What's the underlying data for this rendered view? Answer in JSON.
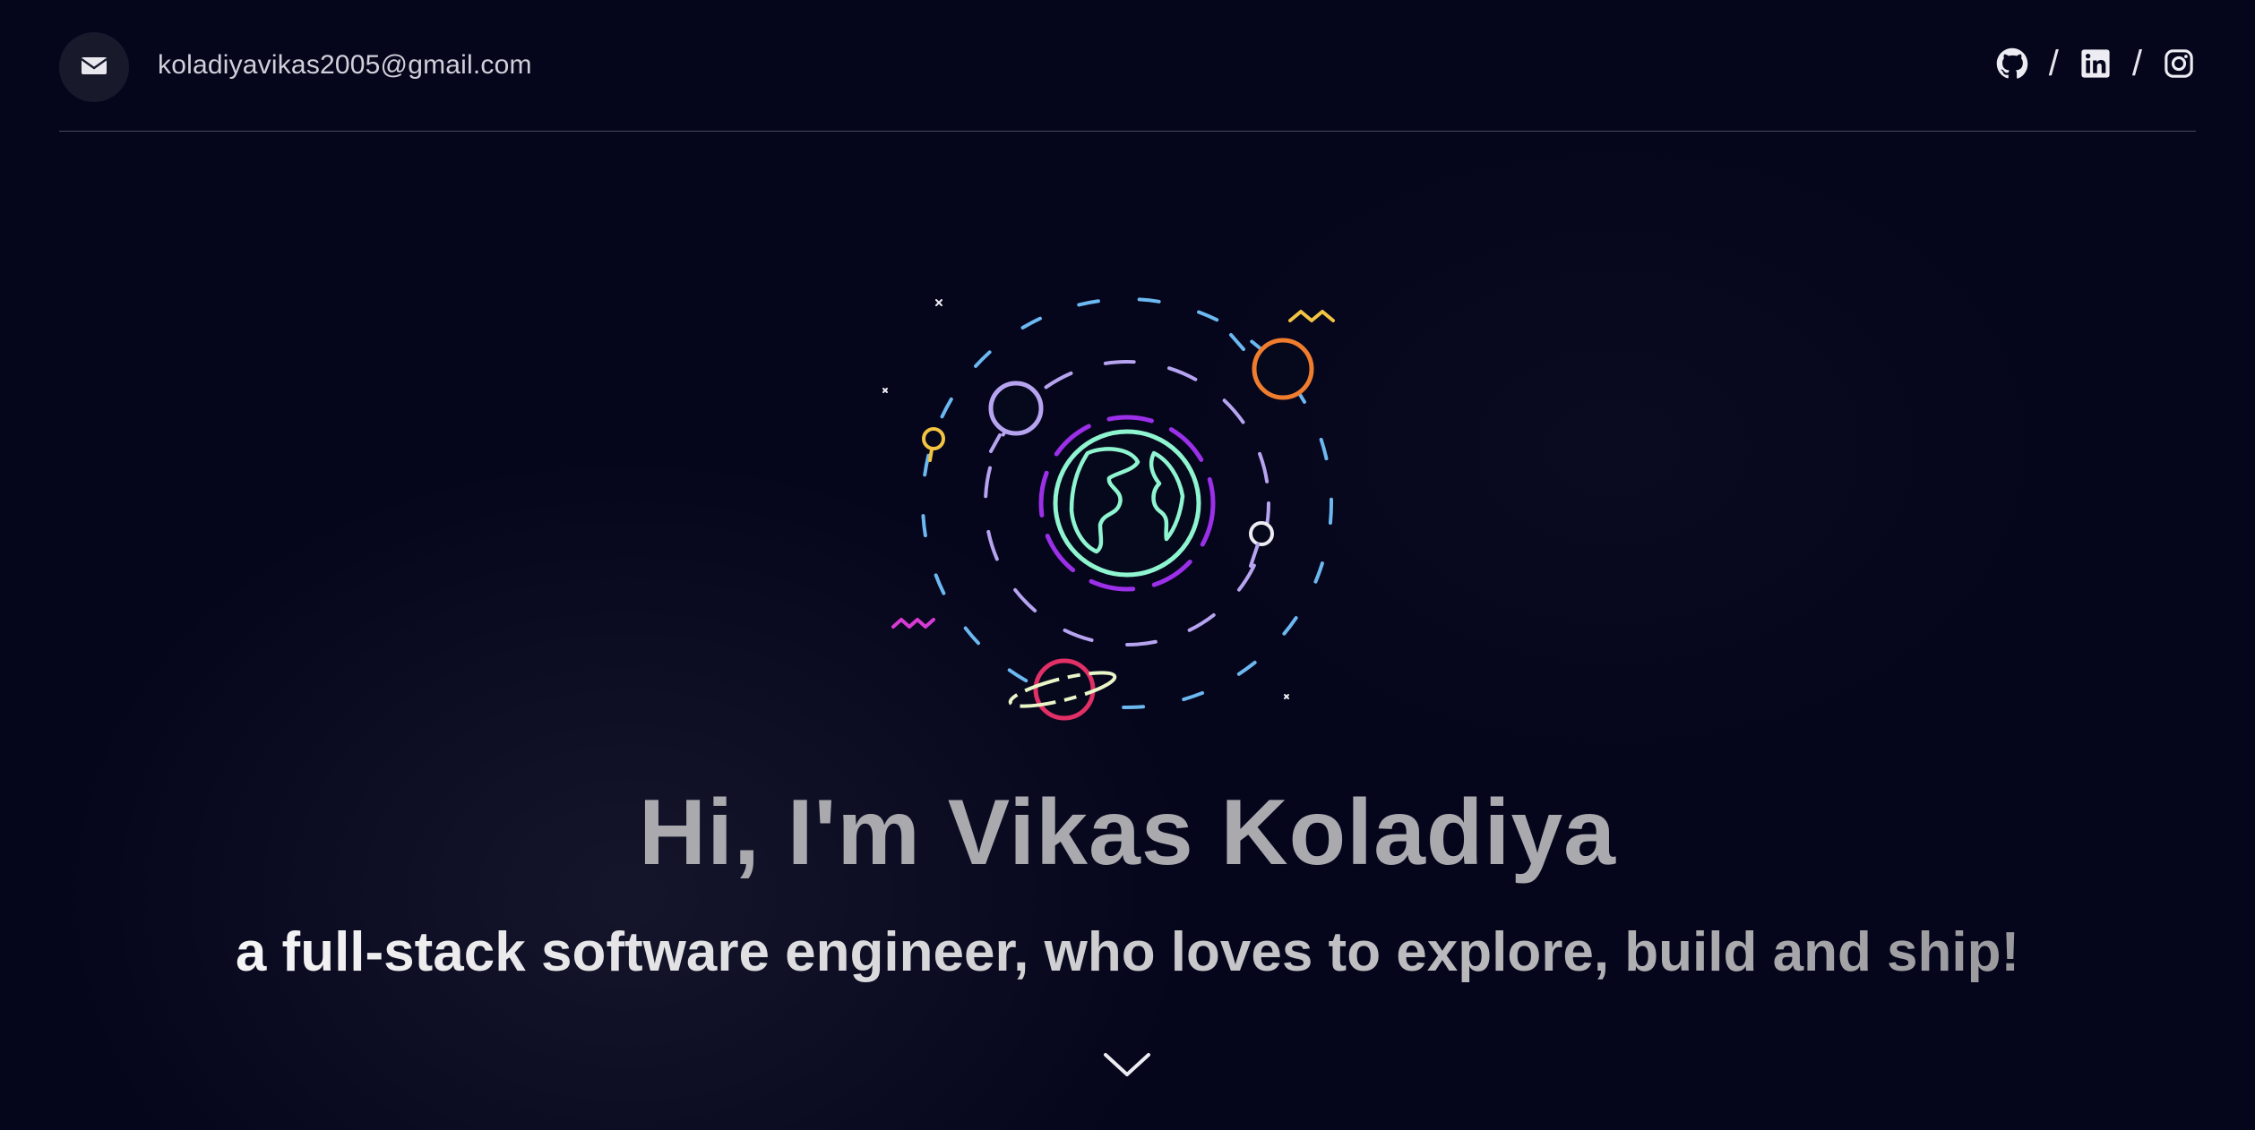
{
  "header": {
    "email": "koladiyavikas2005@gmail.com",
    "mail_icon": "envelope-icon",
    "socials": [
      {
        "name": "GitHub",
        "icon": "github-icon"
      },
      {
        "name": "LinkedIn",
        "icon": "linkedin-icon"
      },
      {
        "name": "Instagram",
        "icon": "instagram-icon"
      }
    ],
    "separator": "/"
  },
  "hero": {
    "title": "Hi, I'm Vikas Koladiya",
    "subtitle": "a full-stack software engineer, who loves to explore, build and ship!",
    "scroll_icon": "chevron-down-icon",
    "illustration_icon": "earth-orbit-illustration"
  },
  "colors": {
    "background": "#05051c",
    "earth": "#8ff5d0",
    "orbit_outer": "#6cb8f0",
    "orbit_inner": "#b7a4f0",
    "accent_purple": "#9b30e8",
    "planet_orange": "#f07c2e",
    "planet_red": "#e03066",
    "planet_yellow": "#f2c442",
    "zigzag_pink": "#d83ad6"
  }
}
